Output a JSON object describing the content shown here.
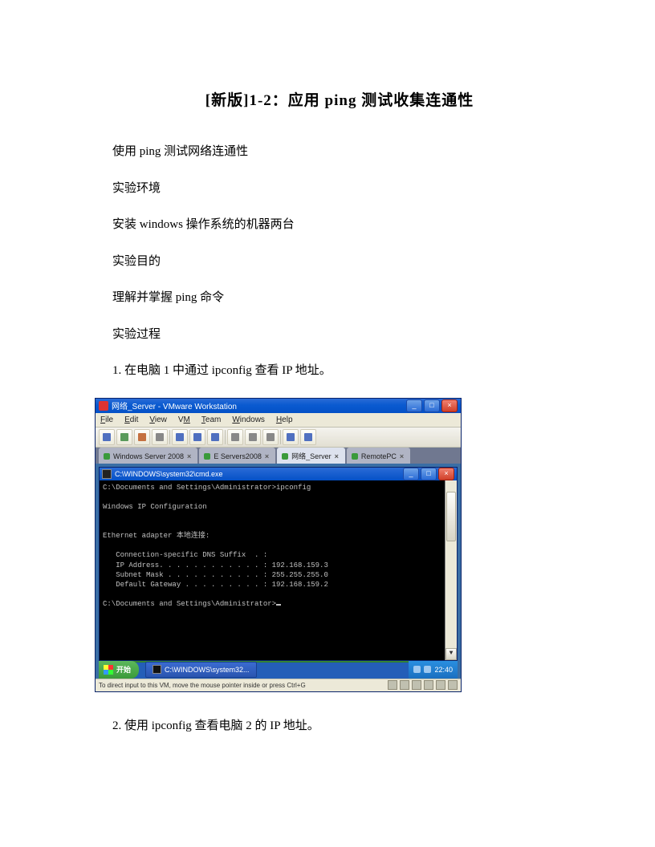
{
  "title": "[新版]1-2：应用 ping 测试收集连通性",
  "paragraphs": {
    "p1": "使用 ping 测试网络连通性",
    "p2": "实验环境",
    "p3": "安装 windows 操作系统的机器两台",
    "p4": "实验目的",
    "p5": "理解并掌握 ping 命令",
    "p6": "实验过程",
    "p7": "1. 在电脑 1 中通过 ipconfig 查看 IP 地址。",
    "p8": "2. 使用 ipconfig 查看电脑 2 的 IP 地址。"
  },
  "vmware": {
    "title": "网络_Server - VMware Workstation",
    "menu": {
      "file": "File",
      "edit": "Edit",
      "view": "View",
      "vm": "VM",
      "team": "Team",
      "windows": "Windows",
      "help": "Help"
    },
    "tabs": {
      "t1": "Windows Server 2008",
      "t2": "E Servers2008",
      "t3": "网络_Server",
      "t4": "RemotePC"
    },
    "status": "To direct input to this VM, move the mouse pointer inside or press Ctrl+G"
  },
  "cmd": {
    "title": "C:\\WINDOWS\\system32\\cmd.exe",
    "l1": "C:\\Documents and Settings\\Administrator>ipconfig",
    "l2": "Windows IP Configuration",
    "l3": "Ethernet adapter 本地连接:",
    "l4": "   Connection-specific DNS Suffix  . :",
    "l5": "   IP Address. . . . . . . . . . . . : 192.168.159.3",
    "l6": "   Subnet Mask . . . . . . . . . . . : 255.255.255.0",
    "l7": "   Default Gateway . . . . . . . . . : 192.168.159.2",
    "l8": "C:\\Documents and Settings\\Administrator>"
  },
  "taskbar": {
    "start": "开始",
    "task": "C:\\WINDOWS\\system32...",
    "clock": "22:40"
  }
}
